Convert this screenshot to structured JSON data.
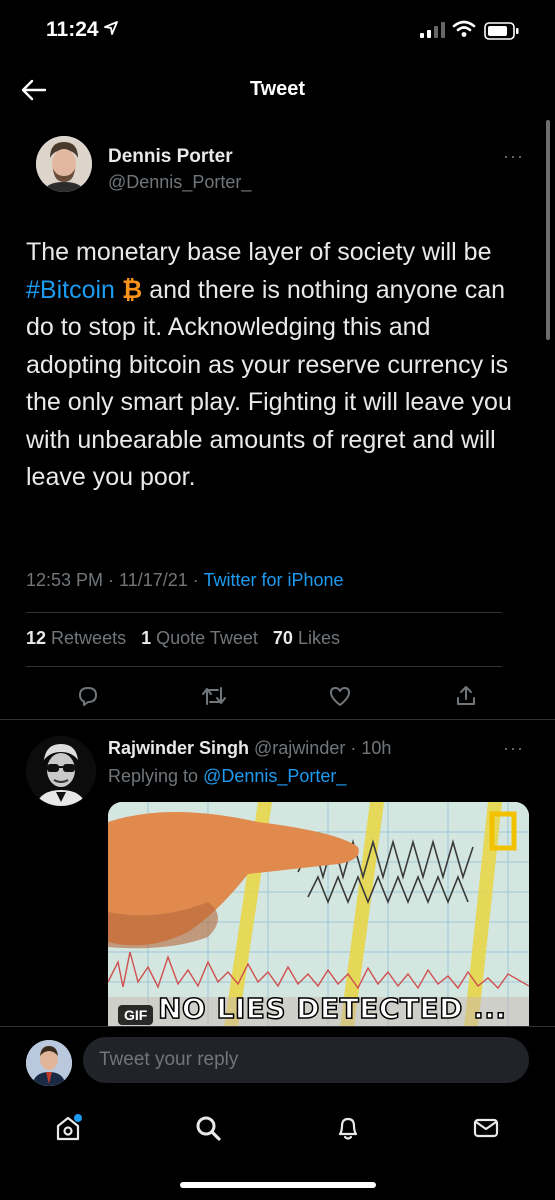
{
  "status_bar": {
    "time": "11:24"
  },
  "nav": {
    "title": "Tweet"
  },
  "tweet": {
    "author_name": "Dennis Porter",
    "author_handle": "@Dennis_Porter_",
    "text_before": "The monetary base layer of society will be ",
    "hashtag": "#Bitcoin",
    "btc_symbol": "₿",
    "text_after": " and there is nothing anyone can do to stop it. Acknowledging this and adopting bitcoin as your reserve currency is the only smart play. Fighting it will leave you with unbearable amounts of regret and will leave you poor.",
    "time": "12:53 PM",
    "date": "11/17/21",
    "separator": " · ",
    "source": "Twitter for iPhone",
    "stats": {
      "retweets_count": "12",
      "retweets_label": "Retweets",
      "quote_count": "1",
      "quote_label": "Quote Tweet",
      "likes_count": "70",
      "likes_label": "Likes"
    },
    "more": "···"
  },
  "reply": {
    "author_name": "Rajwinder Singh",
    "author_handle": "@rajwinder",
    "time_ago": "10h",
    "separator": " · ",
    "replying_prefix": "Replying to ",
    "replying_to": "@Dennis_Porter_",
    "media_badge": "GIF",
    "media_caption": "NO LIES DETECTED ...",
    "more": "···"
  },
  "composer": {
    "placeholder": "Tweet your reply"
  },
  "colors": {
    "accent": "#1d9bf0",
    "bitcoin": "#f7931a",
    "secondary_text": "#71767b",
    "background": "#000000"
  },
  "icons": {
    "back": "arrow-left-icon",
    "reply": "reply-icon",
    "retweet": "retweet-icon",
    "like": "heart-icon",
    "share": "share-icon",
    "home": "home-icon",
    "search": "search-icon",
    "notifications": "bell-icon",
    "messages": "mail-icon"
  }
}
